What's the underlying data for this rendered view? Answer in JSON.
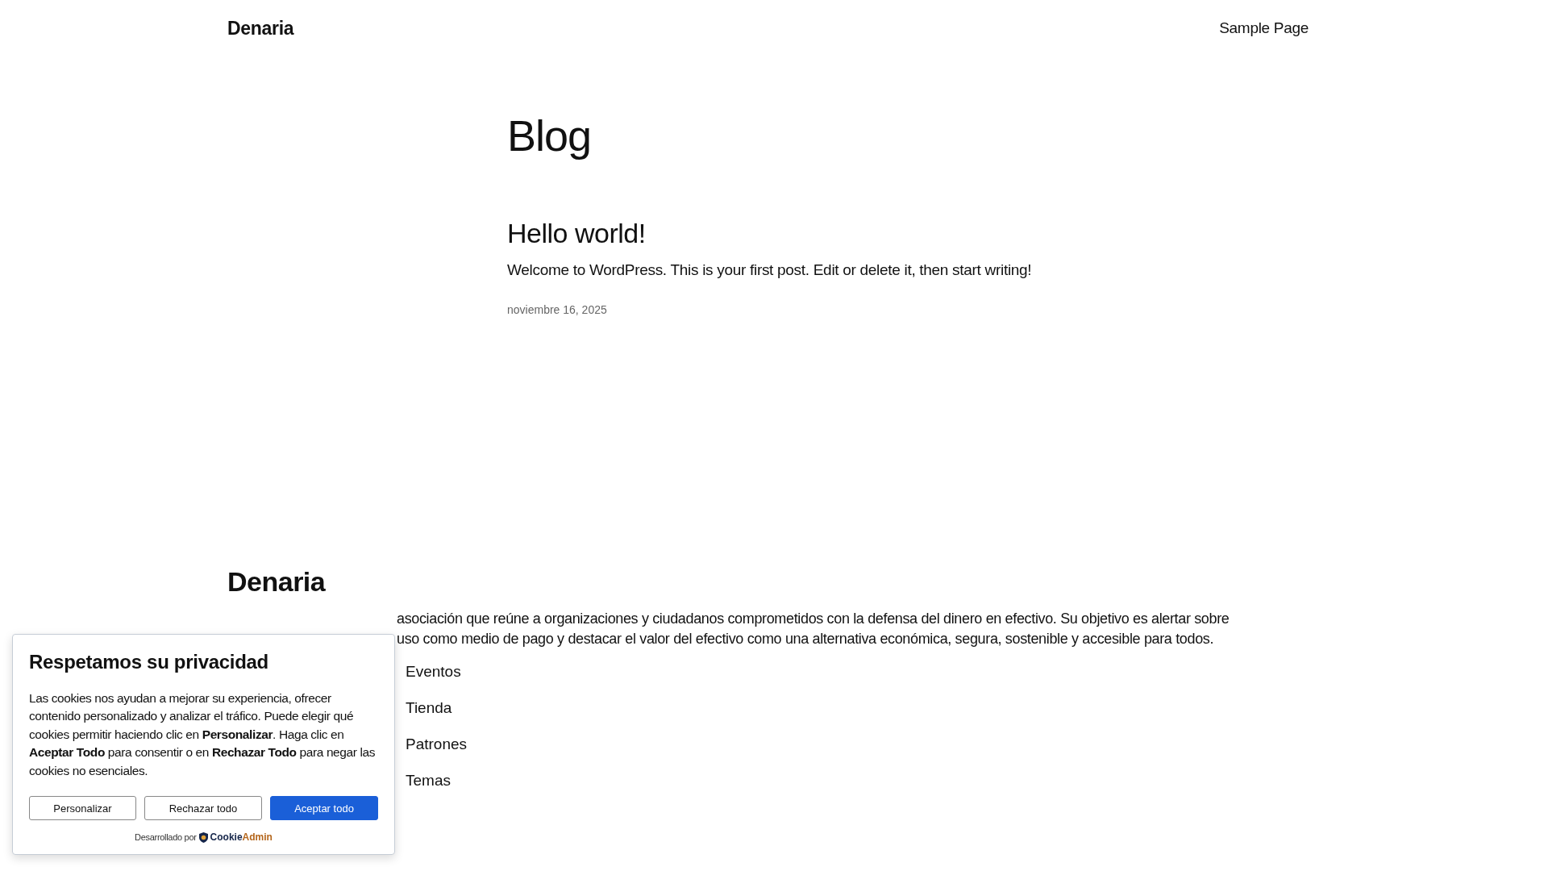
{
  "header": {
    "site_title": "Denaria",
    "nav": [
      {
        "label": "Sample Page"
      }
    ]
  },
  "main": {
    "title": "Blog",
    "posts": [
      {
        "title": "Hello world!",
        "excerpt": "Welcome to WordPress. This is your first post. Edit or delete it, then start writing!",
        "date": "noviembre 16, 2025"
      }
    ]
  },
  "footer": {
    "site_title": "Denaria",
    "description_lines": [
      "asociación que reúne a organizaciones y ciudadanos comprometidos con la defensa del dinero en efectivo. Su objetivo es alertar sobre",
      "uso como medio de pago y destacar el valor del efectivo como una alternativa económica, segura, sostenible y accesible para todos."
    ],
    "nav": [
      {
        "label": "Eventos"
      },
      {
        "label": "Tienda"
      },
      {
        "label": "Patrones"
      },
      {
        "label": "Temas"
      }
    ]
  },
  "cookie_banner": {
    "title": "Respetamos su privacidad",
    "text": "Las cookies nos ayudan a mejorar su experiencia, ofrecer contenido personalizado y analizar el tráfico. Puede elegir qué cookies permitir haciendo clic en **Personalizar**. Haga clic en **Aceptar Todo** para consentir o en **Rechazar Todo** para negar las cookies no esenciales.",
    "buttons": [
      {
        "label": "Personalizar",
        "kind": "outline"
      },
      {
        "label": "Rechazar todo",
        "kind": "outline"
      },
      {
        "label": "Aceptar todo",
        "kind": "primary"
      }
    ],
    "powered_by": "Desarrollado por",
    "brand_name": [
      "Cookie",
      "Admin"
    ]
  }
}
